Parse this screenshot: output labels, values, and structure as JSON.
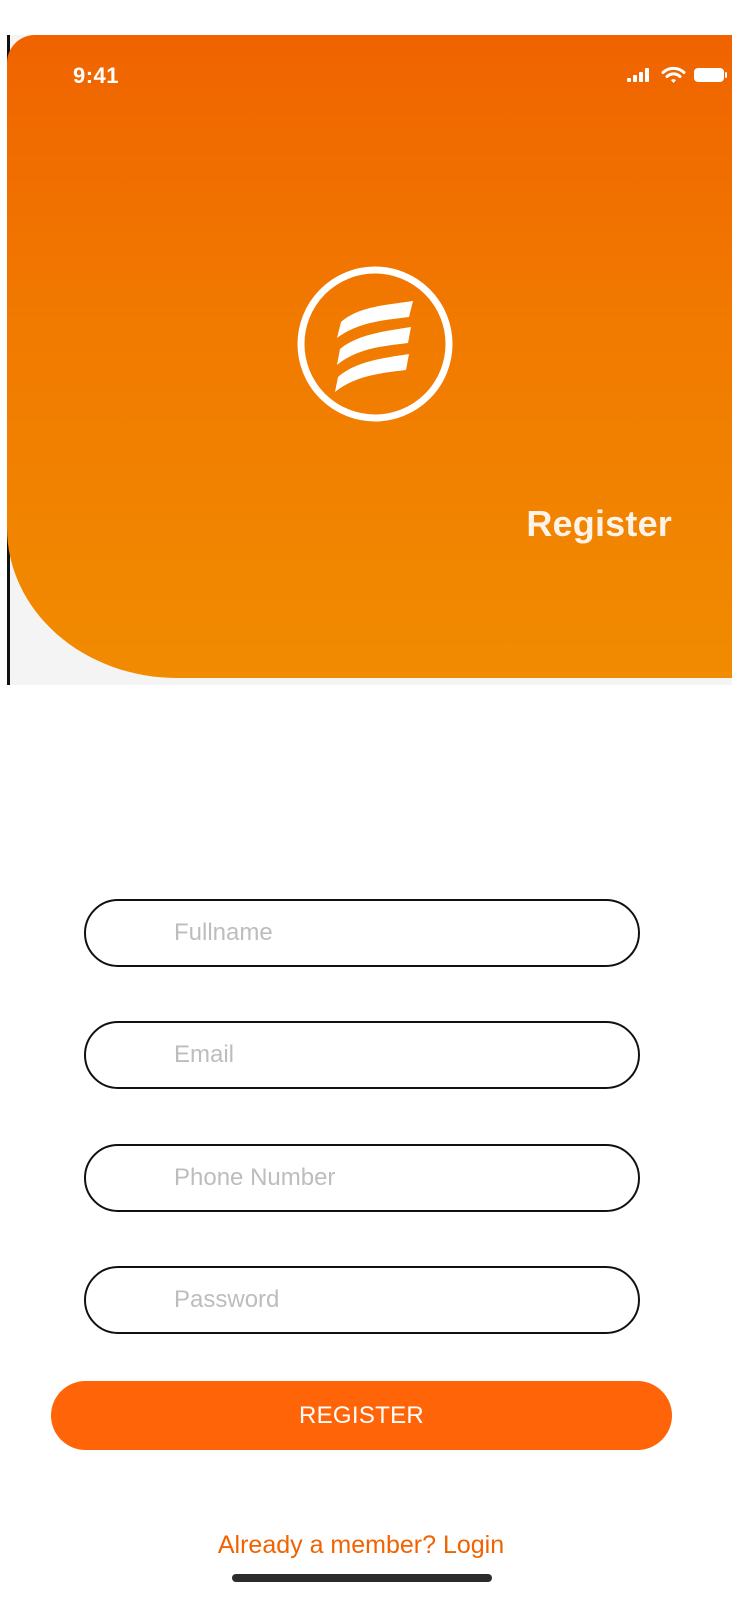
{
  "status_bar": {
    "time": "9:41",
    "icons": [
      "signal-icon",
      "wifi-icon",
      "battery-icon"
    ]
  },
  "header": {
    "title": "Register",
    "logo": "stacked-stripes-logo"
  },
  "form": {
    "fields": [
      {
        "placeholder": "Fullname",
        "value": ""
      },
      {
        "placeholder": "Email",
        "value": ""
      },
      {
        "placeholder": "Phone Number",
        "value": ""
      },
      {
        "placeholder": "Password",
        "value": ""
      }
    ],
    "submit_label": "REGISTER"
  },
  "footer": {
    "login_link": "Already a member? Login"
  },
  "colors": {
    "accent": "#ff6508",
    "header_top": "#f06300",
    "header_bottom": "#f18b00",
    "field_border": "#111111",
    "placeholder": "#bdbdbd"
  }
}
